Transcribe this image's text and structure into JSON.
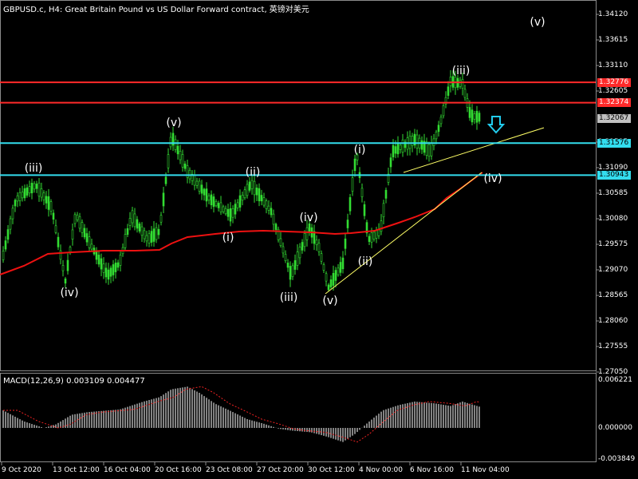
{
  "header": {
    "title": "GBPUSD.c, H4:  Great Britain Pound vs US Dollar Forward contract, 英镑对美元"
  },
  "macd": {
    "title": "MACD(12,26,9) 0.003109 0.004477",
    "axis": [
      "0.006221",
      "0.000000",
      "-0.003849"
    ]
  },
  "price_axis": [
    "1.34120",
    "1.33615",
    "1.33110",
    "1.32605",
    "1.31595",
    "1.31090",
    "1.30585",
    "1.30080",
    "1.29575",
    "1.29070",
    "1.28565",
    "1.28060",
    "1.27555",
    "1.27050"
  ],
  "time_axis": [
    "9 Oct 2020",
    "13 Oct 12:00",
    "16 Oct 04:00",
    "20 Oct 16:00",
    "23 Oct 08:00",
    "27 Oct 20:00",
    "30 Oct 12:00",
    "4 Nov 00:00",
    "6 Nov 16:00",
    "11 Nov 04:00"
  ],
  "levels": [
    {
      "price": "1.32776",
      "color": "#ff2a2a",
      "text": "#ffffff"
    },
    {
      "price": "1.32374",
      "color": "#ff2a2a",
      "text": "#ffffff"
    },
    {
      "price": "1.32067",
      "color": "#c0c0c0",
      "text": "#000000"
    },
    {
      "price": "1.31576",
      "color": "#33ddee",
      "text": "#000000"
    },
    {
      "price": "1.30943",
      "color": "#33ddee",
      "text": "#000000"
    }
  ],
  "waves": [
    "(iii)",
    "(iv)",
    "(v)",
    "(i)",
    "(ii)",
    "(iii)",
    "(iv)",
    "(v)",
    "(i)",
    "(ii)",
    "(iii)",
    "(iv)",
    "(v)"
  ],
  "colors": {
    "candle": "#33dd33",
    "ma": "#ee1111",
    "trend": "#ffff66",
    "arrow": "#22ccee",
    "grid": "#333333"
  }
}
